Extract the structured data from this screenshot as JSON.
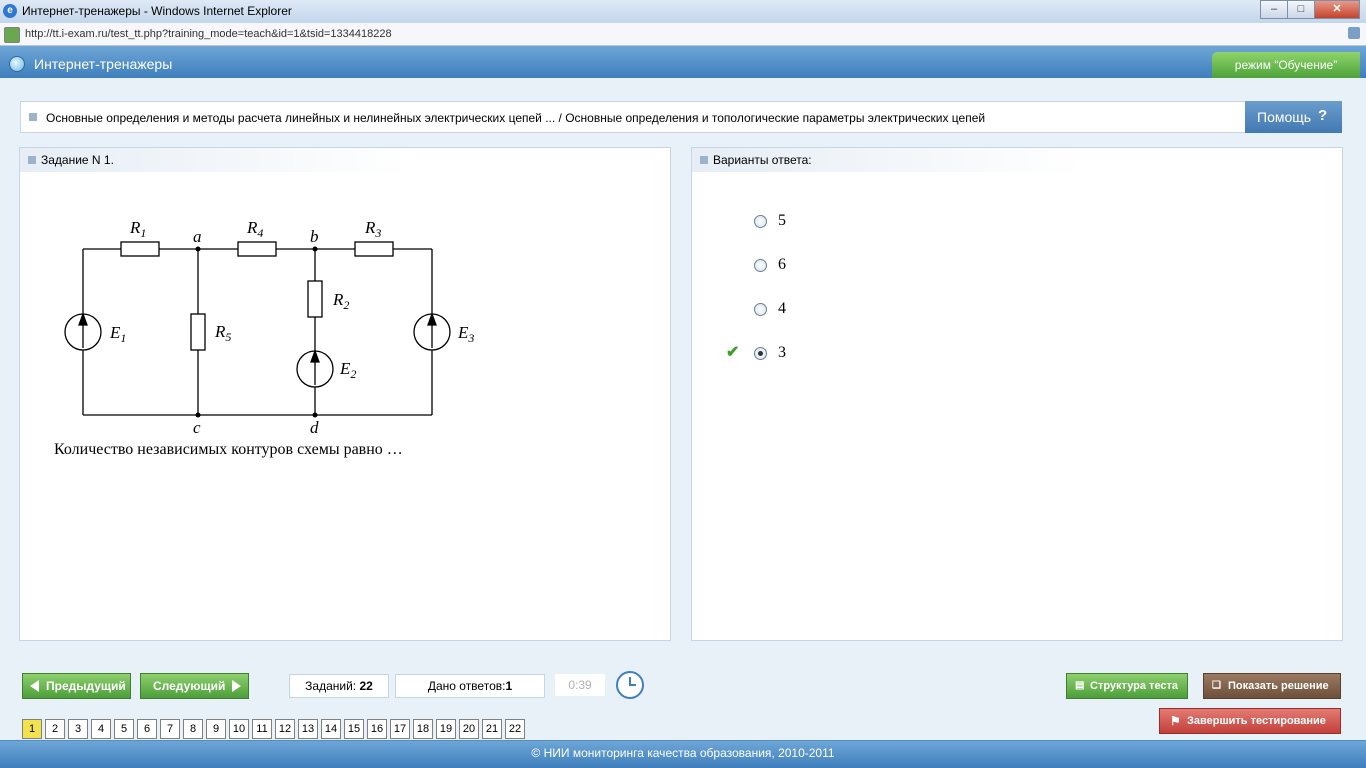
{
  "window": {
    "title": "Интернет-тренажеры - Windows Internet Explorer",
    "url": "http://tt.i-exam.ru/test_tt.php?training_mode=teach&id=1&tsid=1334418228"
  },
  "app": {
    "name": "Интернет-тренажеры",
    "mode": "режим “Обучение”"
  },
  "breadcrumb": "Основные определения и методы расчета линейных и нелинейных электрических цепей ... / Основные определения и топологические параметры электрических цепей",
  "help_label": "Помощь",
  "task": {
    "header": "Задание N 1.",
    "question": "Количество независимых контуров схемы равно …",
    "circuit": {
      "labels": {
        "R1": "R",
        "R1_sub": "1",
        "R4": "R",
        "R4_sub": "4",
        "R3": "R",
        "R3_sub": "3",
        "R2": "R",
        "R2_sub": "2",
        "R5": "R",
        "R5_sub": "5",
        "E1": "E",
        "E1_sub": "1",
        "E2": "E",
        "E2_sub": "2",
        "E3": "E",
        "E3_sub": "3",
        "a": "a",
        "b": "b",
        "c": "c",
        "d": "d"
      }
    }
  },
  "answers": {
    "header": "Варианты ответа:",
    "options": [
      {
        "value": "5",
        "selected": false
      },
      {
        "value": "6",
        "selected": false
      },
      {
        "value": "4",
        "selected": false
      },
      {
        "value": "3",
        "selected": true,
        "correct": true
      }
    ]
  },
  "nav": {
    "prev": "Предыдущий",
    "next": "Следующий",
    "tasks_label": "Заданий:",
    "tasks_count": "22",
    "answers_label": "Дано ответов:",
    "answers_count": "1",
    "timer": "0:39",
    "structure": "Структура теста",
    "show_solution": "Показать решение",
    "finish": "Завершить тестирование",
    "pages": [
      "1",
      "2",
      "3",
      "4",
      "5",
      "6",
      "7",
      "8",
      "9",
      "10",
      "11",
      "12",
      "13",
      "14",
      "15",
      "16",
      "17",
      "18",
      "19",
      "20",
      "21",
      "22"
    ],
    "current_page": "1"
  },
  "footer": "© НИИ мониторинга качества образования, 2010-2011",
  "colors": {
    "accent_blue": "#3f7fbd",
    "green": "#4c9e3a",
    "red": "#c2403a",
    "brown": "#7a5a44"
  }
}
